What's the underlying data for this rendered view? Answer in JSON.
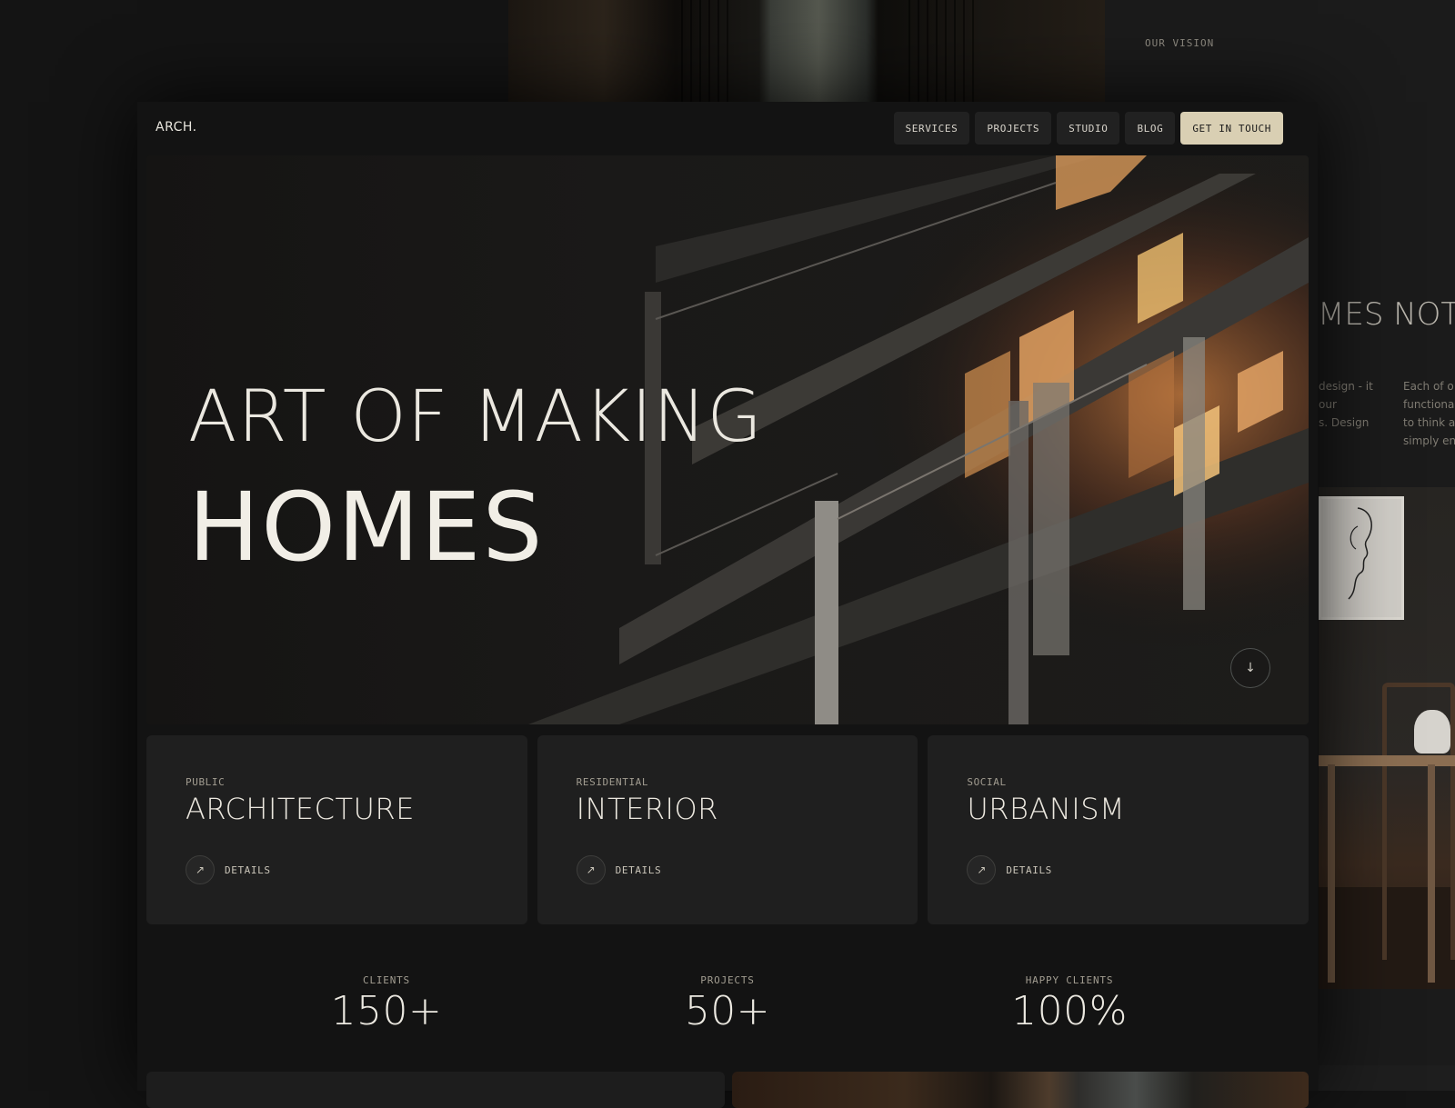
{
  "background_page": {
    "vision_label": "OUR VISION",
    "heading_fragment": "MES NOT",
    "col1_lines": [
      "design - it",
      "our",
      "s. Design"
    ],
    "col2_lines": [
      "Each of o",
      "functional",
      "to think al",
      "simply enj"
    ]
  },
  "header": {
    "logo": "ARCH.",
    "nav": [
      "SERVICES",
      "PROJECTS",
      "STUDIO",
      "BLOG"
    ],
    "cta": "GET IN TOUCH"
  },
  "hero": {
    "title_line1": "ART OF MAKING",
    "title_line2": "HOMES",
    "scroll_icon": "arrow-down-icon",
    "scroll_glyph": "↓"
  },
  "cards": [
    {
      "tag": "PUBLIC",
      "title": "ARCHITECTURE",
      "link": "DETAILS",
      "icon": "arrow-up-right-icon",
      "glyph": "↗"
    },
    {
      "tag": "RESIDENTIAL",
      "title": "INTERIOR",
      "link": "DETAILS",
      "icon": "arrow-up-right-icon",
      "glyph": "↗"
    },
    {
      "tag": "SOCIAL",
      "title": "URBANISM",
      "link": "DETAILS",
      "icon": "arrow-up-right-icon",
      "glyph": "↗"
    }
  ],
  "stats": [
    {
      "label": "CLIENTS",
      "value": "150+"
    },
    {
      "label": "PROJECTS",
      "value": "50+"
    },
    {
      "label": "HAPPY CLIENTS",
      "value": "100%"
    }
  ],
  "colors": {
    "background": "#141414",
    "card": "#1f1f1f",
    "cta": "#d9cfb3",
    "text": "#ebe8e0",
    "accent_warm": "#e0a060"
  }
}
